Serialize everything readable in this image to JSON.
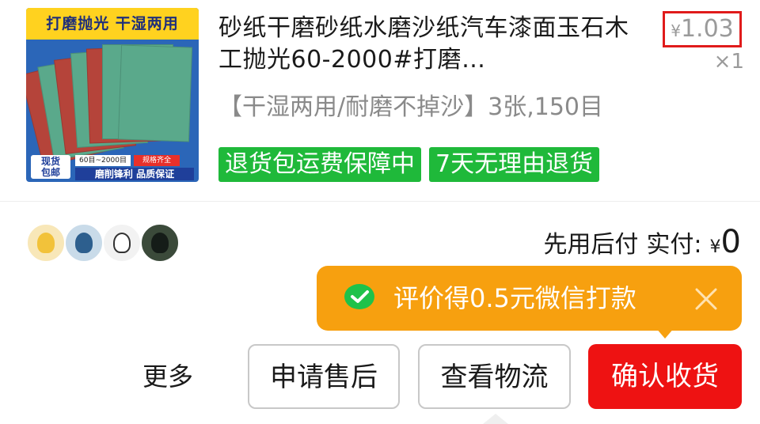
{
  "product": {
    "image": {
      "banner": "打磨抛光 干湿两用",
      "tag_left": "现货\n包邮",
      "tag_range": "60目~2000目",
      "tag_spec": "规格齐全",
      "tag_quality": "磨削锋利 品质保证"
    },
    "title": "砂纸干磨砂纸水磨沙纸汽车漆面玉石木工抛光60-2000#打磨…",
    "price_symbol": "¥",
    "price": "1.03",
    "quantity": "×1",
    "spec": "【干湿两用/耐磨不掉沙】3张,150目",
    "badges": [
      "退货包运费保障中",
      "7天无理由退货"
    ]
  },
  "payment": {
    "mode": "先用后付",
    "label": "实付:",
    "symbol": "¥",
    "amount": "0"
  },
  "tooltip": {
    "text": "评价得0.5元微信打款",
    "icon": "wechat-icon",
    "close_icon": "close-icon"
  },
  "actions": {
    "more": "更多",
    "after_sales": "申请售后",
    "logistics": "查看物流",
    "confirm": "确认收货"
  },
  "colors": {
    "accent_red": "#ee1212",
    "badge_green": "#1fb93a",
    "tooltip_orange": "#f7a00f",
    "price_box_red": "#e01b1b"
  }
}
